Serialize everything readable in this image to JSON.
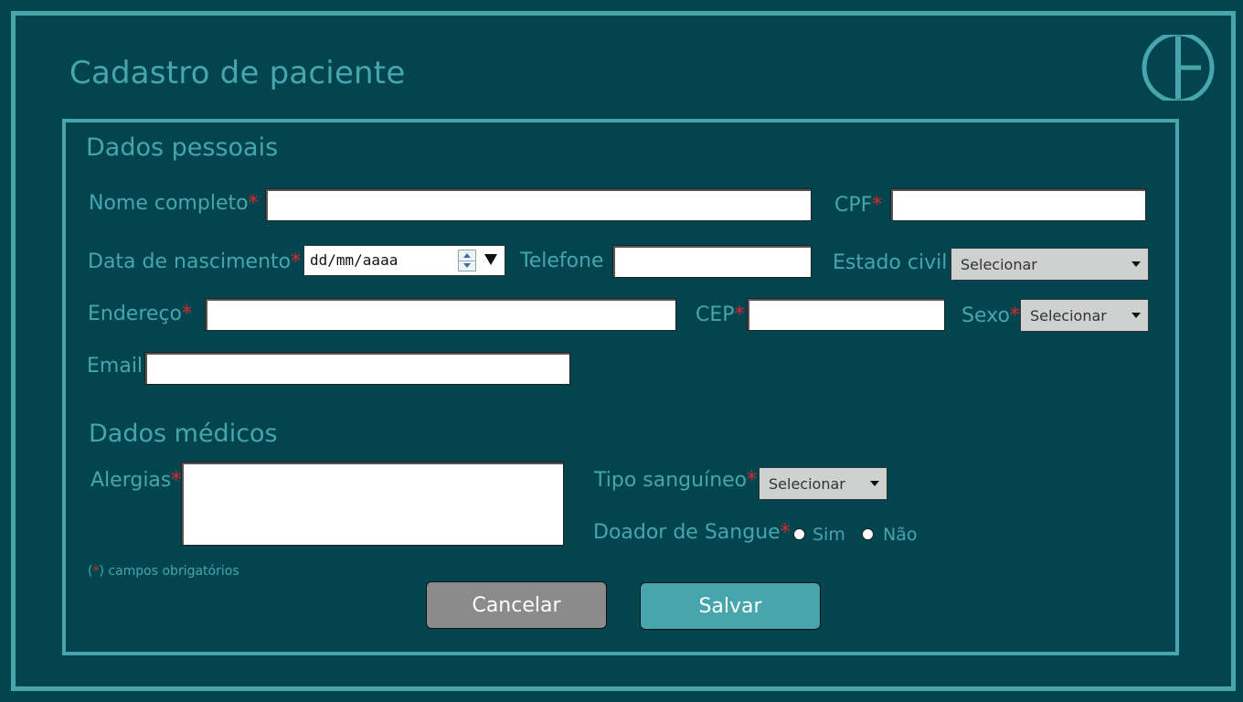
{
  "page": {
    "title": "Cadastro de paciente"
  },
  "personal": {
    "section_title": "Dados pessoais",
    "nome_label": "Nome completo",
    "cpf_label": "CPF",
    "data_label": "Data de nascimento",
    "data_placeholder": "dd/mm/aaaa",
    "telefone_label": "Telefone",
    "estado_civil_label": "Estado civil",
    "estado_civil_value": "Selecionar",
    "endereco_label": "Endereço",
    "cep_label": "CEP",
    "sexo_label": "Sexo",
    "sexo_value": "Selecionar",
    "email_label": "Email"
  },
  "medical": {
    "section_title": "Dados médicos",
    "alergias_label": "Alergias",
    "tipo_label": "Tipo sanguíneo",
    "tipo_value": "Selecionar",
    "doador_label": "Doador de Sangue",
    "option_sim": "Sim",
    "option_nao": "Não"
  },
  "footer": {
    "req_mark_open": "(",
    "req_mark_star": "*",
    "req_note": ") campos obrigatórios",
    "cancel_label": "Cancelar",
    "save_label": "Salvar"
  },
  "required_mark": "*",
  "colors": {
    "background": "#02454e",
    "accent": "#47a5ae",
    "required": "#e0262b",
    "cancel": "#8b8b8b"
  },
  "icons": {
    "logo": "app-logo-icon"
  }
}
